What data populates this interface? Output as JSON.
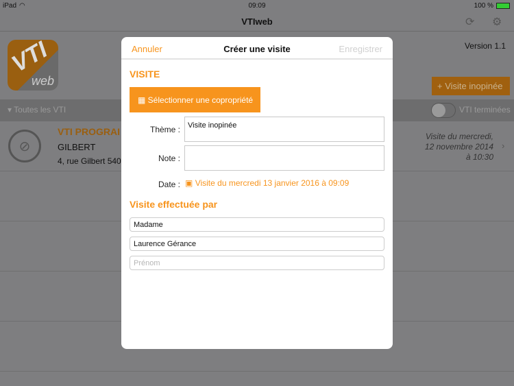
{
  "status": {
    "device": "iPad",
    "time": "09:09",
    "battery": "100 %"
  },
  "nav": {
    "title": "VTIweb"
  },
  "header": {
    "logo_text": "VTI",
    "logo_sub": "web",
    "version": "Version 1.1",
    "quick_button": "+ Visite inopinée"
  },
  "filter": {
    "label": "▾ Toutes les VTI",
    "toggle_label": "VTI terminées",
    "toggle_on": false
  },
  "list": [
    {
      "title": "VTI PROGRAI",
      "name": "GILBERT",
      "address": "4, rue Gilbert 540",
      "date_line1": "Visite du mercredi,",
      "date_line2": "12 novembre 2014",
      "date_line3": "à 10:30"
    }
  ],
  "modal": {
    "cancel": "Annuler",
    "title": "Créer une visite",
    "save": "Enregistrer",
    "section_visit": "VISITE",
    "select_button": "Sélectionner une copropriété",
    "theme_label": "Thème :",
    "theme_value": "Visite inopinée",
    "note_label": "Note :",
    "note_value": "",
    "date_label": "Date :",
    "date_value": "Visite du mercredi 13 janvier 2016 à 09:09",
    "section_by": "Visite effectuée par",
    "civility": "Madame",
    "name": "Laurence Gérance",
    "firstname_placeholder": "Prénom"
  },
  "colors": {
    "accent": "#f7941d"
  }
}
